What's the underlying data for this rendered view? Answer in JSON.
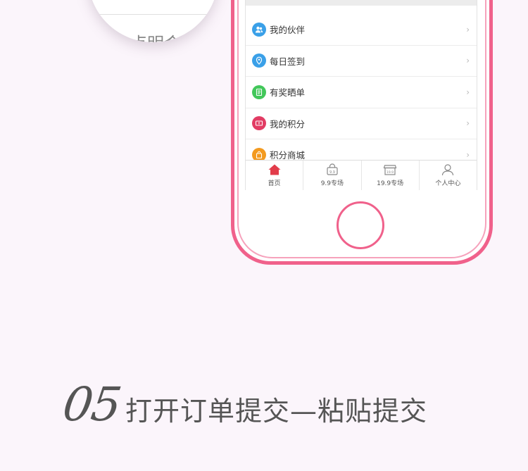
{
  "magnifier": {
    "partial_text": "点明合"
  },
  "menu": [
    {
      "label": "我的伙伴",
      "icon": "partner-icon",
      "color": "#3aa0e8",
      "glyph": "👥"
    },
    {
      "label": "每日签到",
      "icon": "location-pin-icon",
      "color": "#3aa0e8",
      "glyph": "◉"
    },
    {
      "label": "有奖晒单",
      "icon": "document-icon",
      "color": "#42c75a",
      "glyph": "▤"
    },
    {
      "label": "我的积分",
      "icon": "points-ticket-icon",
      "color": "#e23c64",
      "glyph": "¥"
    },
    {
      "label": "积分商城",
      "icon": "shopping-bag-icon",
      "color": "#f39a1f",
      "glyph": "▣"
    }
  ],
  "chevron": "›",
  "tabs": [
    {
      "label": "首页",
      "icon": "home-icon",
      "active": true
    },
    {
      "label": "9.9专场",
      "icon": "basket-9-9-icon",
      "active": false
    },
    {
      "label": "19.9专场",
      "icon": "store-19-9-icon",
      "active": false
    },
    {
      "label": "个人中心",
      "icon": "person-icon",
      "active": false
    }
  ],
  "caption": {
    "step": "05",
    "text": "打开订单提交—粘贴提交"
  },
  "colors": {
    "accent": "#f0618b",
    "background": "#fbf5fb",
    "home_active": "#e23c4a"
  }
}
